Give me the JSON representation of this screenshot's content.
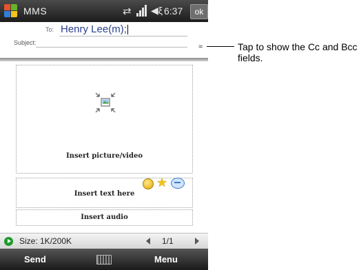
{
  "titlebar": {
    "app_title": "MMS",
    "clock": "6:37",
    "ok_label": "ok"
  },
  "header": {
    "to_label": "To:",
    "to_value": "Henry Lee(m);",
    "subject_label": "Subject:",
    "expand_glyph": "≈"
  },
  "slide": {
    "picture_label": "Insert picture/video",
    "text_label": "Insert text here",
    "audio_label": "Insert audio"
  },
  "status": {
    "size": "Size: 1K/200K",
    "page": "1/1"
  },
  "softkeys": {
    "left": "Send",
    "right": "Menu"
  },
  "callout": {
    "text": "Tap to show the Cc and Bcc fields."
  },
  "icons": {
    "start": "windows-logo-icon",
    "connectivity": "sync-arrows-icon",
    "signal": "signal-strength-icon",
    "volume": "speaker-icon",
    "picture": "picture-placeholder-icon",
    "emoticon": "smiley-icon",
    "favorite": "star-icon",
    "message": "speech-bubble-icon",
    "play": "play-icon",
    "keyboard": "keyboard-icon"
  },
  "colors": {
    "title_bar": "#1c1c1c",
    "recipient_text": "#2a3f8f",
    "play_button": "#1d9a2c"
  }
}
